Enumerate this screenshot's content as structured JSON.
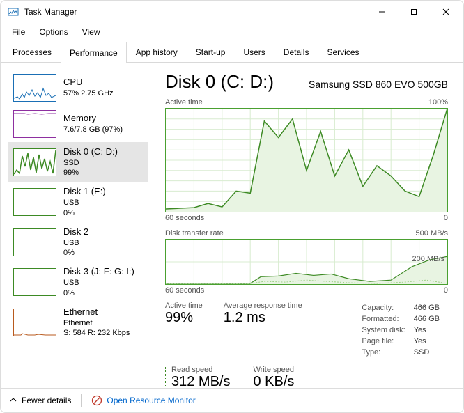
{
  "window": {
    "title": "Task Manager"
  },
  "menu": [
    "File",
    "Options",
    "View"
  ],
  "tabs": [
    "Processes",
    "Performance",
    "App history",
    "Start-up",
    "Users",
    "Details",
    "Services"
  ],
  "active_tab": 1,
  "sidebar": [
    {
      "name": "CPU",
      "sub": "57% 2.75 GHz",
      "color": "#1a6fb5"
    },
    {
      "name": "Memory",
      "sub": "7.6/7.8 GB (97%)",
      "color": "#8e2fa0"
    },
    {
      "name": "Disk 0 (C: D:)",
      "sub": "SSD",
      "sub2": "99%",
      "color": "#3d8a24",
      "selected": true
    },
    {
      "name": "Disk 1 (E:)",
      "sub": "USB",
      "sub2": "0%",
      "color": "#3d8a24"
    },
    {
      "name": "Disk 2",
      "sub": "USB",
      "sub2": "0%",
      "color": "#3d8a24"
    },
    {
      "name": "Disk 3 (J: F: G: I:)",
      "sub": "USB",
      "sub2": "0%",
      "color": "#3d8a24"
    },
    {
      "name": "Ethernet",
      "sub": "Ethernet",
      "sub2": "S: 584 R: 232 Kbps",
      "color": "#b85a1e"
    }
  ],
  "detail": {
    "title": "Disk 0 (C: D:)",
    "model": "Samsung SSD 860 EVO 500GB",
    "chart1": {
      "label": "Active time",
      "max": "100%",
      "xleft": "60 seconds",
      "xright": "0"
    },
    "chart2": {
      "label": "Disk transfer rate",
      "max": "500 MB/s",
      "xleft": "60 seconds",
      "xright": "0",
      "inner": "200 MB/s"
    },
    "stats": {
      "active_time": {
        "label": "Active time",
        "value": "99%"
      },
      "avg_resp": {
        "label": "Average response time",
        "value": "1.2 ms"
      },
      "read": {
        "label": "Read speed",
        "value": "312 MB/s"
      },
      "write": {
        "label": "Write speed",
        "value": "0 KB/s"
      }
    },
    "props": [
      [
        "Capacity:",
        "466 GB"
      ],
      [
        "Formatted:",
        "466 GB"
      ],
      [
        "System disk:",
        "Yes"
      ],
      [
        "Page file:",
        "Yes"
      ],
      [
        "Type:",
        "SSD"
      ]
    ]
  },
  "footer": {
    "fewer": "Fewer details",
    "orm": "Open Resource Monitor"
  },
  "chart_data": [
    {
      "type": "area",
      "title": "Active time",
      "ylabel": "%",
      "ylim": [
        0,
        100
      ],
      "xlabel": "seconds ago",
      "xlim": [
        60,
        0
      ],
      "x": [
        60,
        57,
        54,
        51,
        48,
        45,
        42,
        39,
        36,
        33,
        30,
        27,
        24,
        21,
        18,
        15,
        12,
        9,
        6,
        3,
        0
      ],
      "values": [
        3,
        4,
        4,
        8,
        5,
        20,
        18,
        88,
        72,
        90,
        40,
        78,
        35,
        60,
        25,
        45,
        35,
        20,
        15,
        55,
        100
      ]
    },
    {
      "type": "line",
      "title": "Disk transfer rate",
      "ylabel": "MB/s",
      "ylim": [
        0,
        500
      ],
      "xlabel": "seconds ago",
      "xlim": [
        60,
        0
      ],
      "series": [
        {
          "name": "Read",
          "x": [
            60,
            55,
            50,
            45,
            40,
            35,
            30,
            25,
            20,
            15,
            10,
            5,
            0
          ],
          "values": [
            0,
            0,
            0,
            0,
            80,
            90,
            110,
            85,
            95,
            60,
            40,
            150,
            312
          ]
        },
        {
          "name": "Write",
          "x": [
            60,
            55,
            50,
            45,
            40,
            35,
            30,
            25,
            20,
            15,
            10,
            5,
            0
          ],
          "values": [
            0,
            0,
            0,
            0,
            30,
            20,
            40,
            25,
            30,
            10,
            5,
            20,
            0
          ]
        }
      ],
      "annotations": [
        "200 MB/s"
      ]
    }
  ]
}
